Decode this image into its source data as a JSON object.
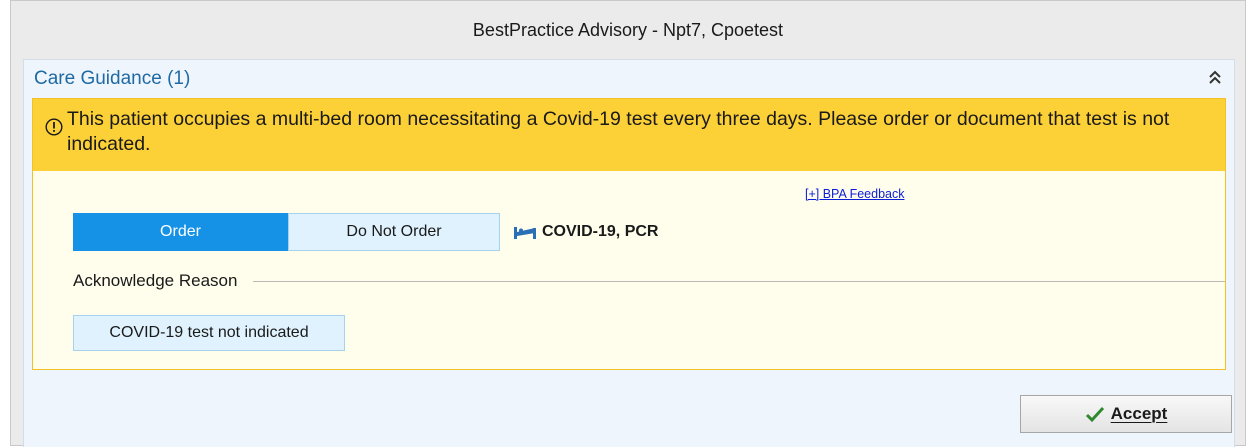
{
  "window": {
    "title": "BestPractice Advisory - Npt7, Cpoetest"
  },
  "section": {
    "title": "Care Guidance (1)",
    "collapse_icon": "double-chevron-up-icon"
  },
  "advisory": {
    "banner_color": "#fcd037",
    "alert_icon": "exclamation-circle-icon",
    "message": "This patient occupies a multi-bed room necessitating a Covid-19 test every three days.  Please order or document that test is not indicated.",
    "feedback_link": "[+] BPA Feedback"
  },
  "order_toggle": {
    "order_label": "Order",
    "do_not_order_label": "Do Not Order",
    "selected": "Order",
    "selected_color": "#1592e6"
  },
  "order_item": {
    "icon": "hospital-bed-icon",
    "label": "COVID-19, PCR"
  },
  "acknowledge": {
    "label": "Acknowledge Reason",
    "reason_label": "COVID-19 test not indicated"
  },
  "footer": {
    "accept_label": "Accept",
    "accept_icon": "checkmark-icon"
  }
}
